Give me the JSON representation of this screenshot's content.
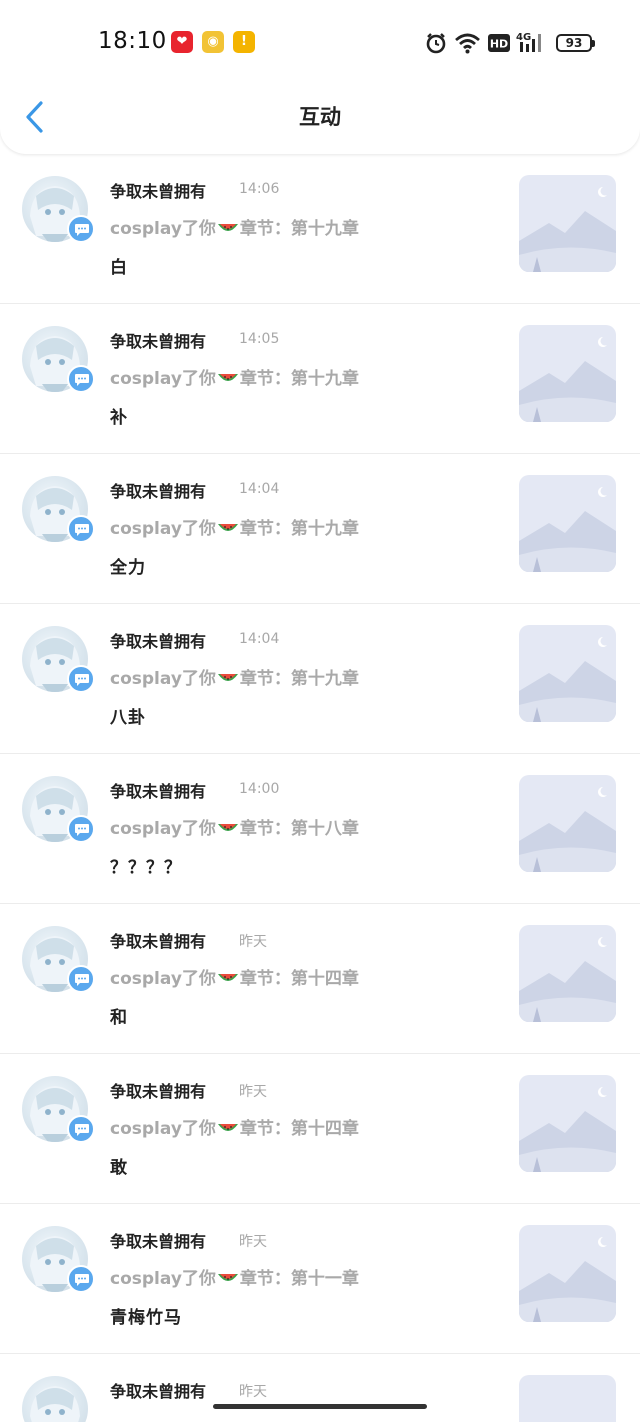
{
  "status_bar": {
    "time": "18:10",
    "battery": "93",
    "icons": [
      "alarm-icon",
      "wifi-icon",
      "hd-icon",
      "4g-signal-icon"
    ],
    "notifications": [
      "app-notification-icon",
      "weibo-icon",
      "notification-icon"
    ]
  },
  "header": {
    "title": "互动",
    "back_icon": "chevron-left-icon"
  },
  "colors": {
    "accent": "#3a97e6",
    "badge": "#5aa8ee",
    "muted_text": "#a9a9a9",
    "thumbnail_bg": "#e4e8f4"
  },
  "items": [
    {
      "user": "争取未曾拥有",
      "time": "14:06",
      "source_prefix": "cosplay了你",
      "source_suffix": "章节：第十九章",
      "comment": "白"
    },
    {
      "user": "争取未曾拥有",
      "time": "14:05",
      "source_prefix": "cosplay了你",
      "source_suffix": "章节：第十九章",
      "comment": "补"
    },
    {
      "user": "争取未曾拥有",
      "time": "14:04",
      "source_prefix": "cosplay了你",
      "source_suffix": "章节：第十九章",
      "comment": "全力"
    },
    {
      "user": "争取未曾拥有",
      "time": "14:04",
      "source_prefix": "cosplay了你",
      "source_suffix": "章节：第十九章",
      "comment": "八卦"
    },
    {
      "user": "争取未曾拥有",
      "time": "14:00",
      "source_prefix": "cosplay了你",
      "source_suffix": "章节：第十八章",
      "comment": "？？？？"
    },
    {
      "user": "争取未曾拥有",
      "time": "昨天",
      "source_prefix": "cosplay了你",
      "source_suffix": "章节：第十四章",
      "comment": "和"
    },
    {
      "user": "争取未曾拥有",
      "time": "昨天",
      "source_prefix": "cosplay了你",
      "source_suffix": "章节：第十四章",
      "comment": "敢"
    },
    {
      "user": "争取未曾拥有",
      "time": "昨天",
      "source_prefix": "cosplay了你",
      "source_suffix": "章节：第十一章",
      "comment": "青梅竹马"
    },
    {
      "user": "争取未曾拥有",
      "time": "昨天",
      "source_prefix": "",
      "source_suffix": "",
      "comment": ""
    }
  ]
}
